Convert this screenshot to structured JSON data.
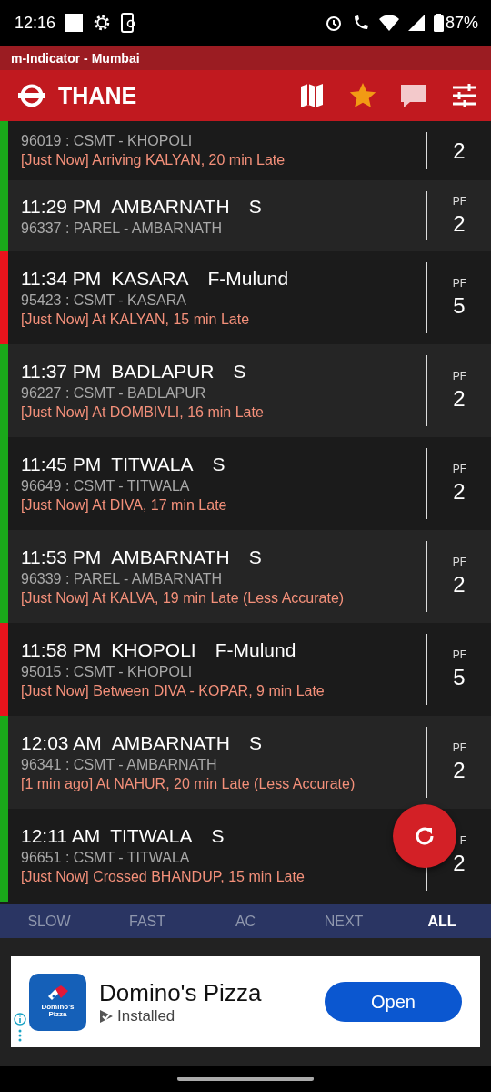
{
  "status_bar": {
    "time": "12:16",
    "battery": "87%"
  },
  "app_title": "m-Indicator - Mumbai",
  "toolbar": {
    "station": "THANE"
  },
  "trains": [
    {
      "partial": true,
      "color": "#1aa81a",
      "train_no": "96019 : CSMT - KHOPOLI",
      "status": "[Just Now] Arriving KALYAN, 20 min Late",
      "pf": "2"
    },
    {
      "color": "#1aa81a",
      "time": "11:29 PM",
      "destination": "AMBARNATH",
      "type": "S",
      "train_no": "96337 : PAREL - AMBARNATH",
      "pf_label": "PF",
      "pf": "2"
    },
    {
      "color": "#e8141c",
      "time": "11:34 PM",
      "destination": "KASARA",
      "type": "F-Mulund",
      "train_no": "95423 : CSMT - KASARA",
      "status": "[Just Now] At KALYAN, 15 min Late",
      "pf_label": "PF",
      "pf": "5"
    },
    {
      "color": "#1aa81a",
      "time": "11:37 PM",
      "destination": "BADLAPUR",
      "type": "S",
      "train_no": "96227 : CSMT - BADLAPUR",
      "status": "[Just Now] At DOMBIVLI, 16 min Late",
      "pf_label": "PF",
      "pf": "2"
    },
    {
      "color": "#1aa81a",
      "time": "11:45 PM",
      "destination": "TITWALA",
      "type": "S",
      "train_no": "96649 : CSMT - TITWALA",
      "status": "[Just Now] At DIVA, 17 min Late",
      "pf_label": "PF",
      "pf": "2"
    },
    {
      "color": "#1aa81a",
      "time": "11:53 PM",
      "destination": "AMBARNATH",
      "type": "S",
      "train_no": "96339 : PAREL - AMBARNATH",
      "status": "[Just Now] At KALVA, 19 min Late (Less Accurate)",
      "pf_label": "PF",
      "pf": "2"
    },
    {
      "color": "#e8141c",
      "time": "11:58 PM",
      "destination": "KHOPOLI",
      "type": "F-Mulund",
      "train_no": "95015 : CSMT - KHOPOLI",
      "status": "[Just Now] Between DIVA - KOPAR, 9 min Late",
      "pf_label": "PF",
      "pf": "5"
    },
    {
      "color": "#1aa81a",
      "time": "12:03 AM",
      "destination": "AMBARNATH",
      "type": "S",
      "train_no": "96341 : CSMT - AMBARNATH",
      "status": "[1 min ago] At NAHUR, 20 min Late (Less Accurate)",
      "pf_label": "PF",
      "pf": "2"
    },
    {
      "color": "#1aa81a",
      "time": "12:11 AM",
      "destination": "TITWALA",
      "type": "S",
      "train_no": "96651 : CSMT - TITWALA",
      "status": "[Just Now] Crossed BHANDUP, 15 min Late",
      "pf_label": "F",
      "pf": "2"
    }
  ],
  "tabs": [
    {
      "label": "SLOW",
      "selected": false
    },
    {
      "label": "FAST",
      "selected": false
    },
    {
      "label": "AC",
      "selected": false
    },
    {
      "label": "NEXT",
      "selected": false
    },
    {
      "label": "ALL",
      "selected": true
    }
  ],
  "ad": {
    "app_name": "Domino's Pizza",
    "icon_text": "Domino's Pizza",
    "status": "Installed",
    "button": "Open"
  }
}
